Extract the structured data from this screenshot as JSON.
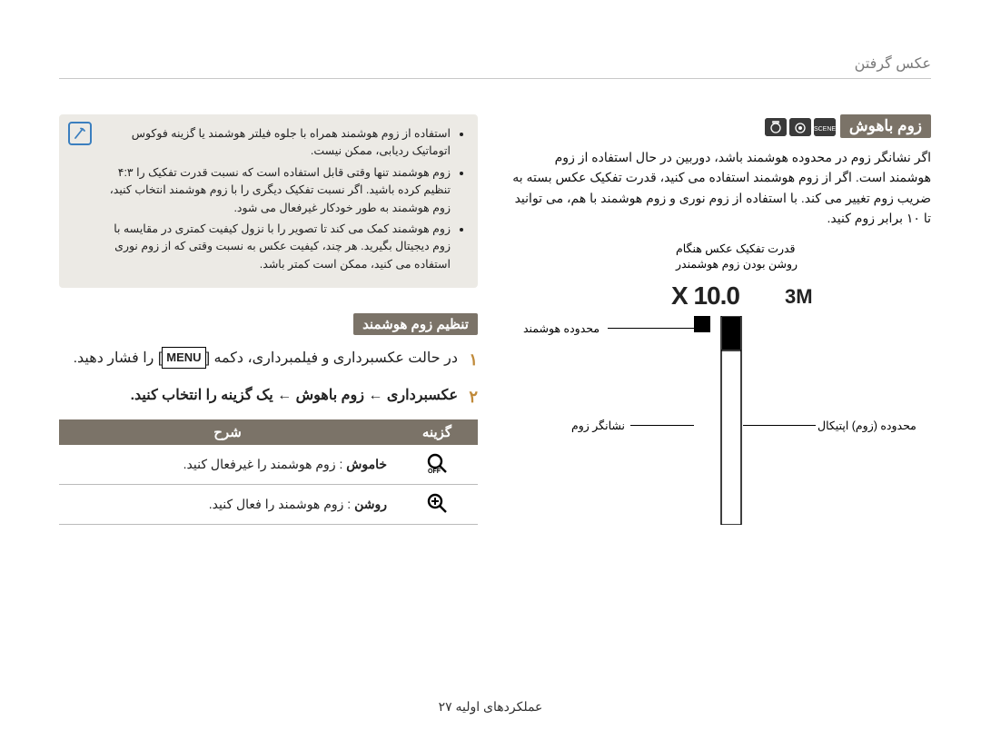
{
  "running_head": "عکس گرفتن",
  "footer": "عملکردهای اولیه ۲۷",
  "right": {
    "heading": "زوم باهوش",
    "para": "اگر نشانگر زوم در محدوده هوشمند باشد، دوربین در حال استفاده از زوم هوشمند است. اگر از زوم هوشمند استفاده می کنید، قدرت تفکیک عکس بسته به ضریب زوم تغییر می کند. با استفاده از زوم نوری و زوم هوشمند با هم، می توانید تا ۱۰ برابر زوم کنید.",
    "labels": {
      "res": "قدرت تفکیک عکس هنگام",
      "sz_on": "روشن بودن زوم هوشمندر",
      "range_smart": "محدوده هوشمند",
      "range_optical": "محدوده (زوم) اپتیکال",
      "zoom_indicator": "نشانگر زوم"
    },
    "diagram": {
      "zoom_text": "X 10.0",
      "size_text": "3M"
    }
  },
  "left": {
    "notes": [
      "استفاده از زوم هوشمند همراه با جلوه فیلتر هوشمند یا گزینه فوکوس اتوماتیک ردیابی، ممکن نیست.",
      "زوم هوشمند تنها وقتی قابل استفاده است که نسبت قدرت تفکیک را ۴:۳ تنظیم کرده باشید. اگر نسبت تفکیک دیگری را با زوم هوشمند انتخاب کنید، زوم هوشمند به طور خودکار غیرفعال می شود.",
      "زوم هوشمند کمک می کند تا تصویر را با نزول کیفیت کمتری در مقایسه با زوم دیجیتال بگیرید. هر چند، کیفیت عکس به نسبت وقتی که از زوم نوری استفاده می کنید، ممکن است کمتر باشد."
    ],
    "subheading": "تنظیم زوم هوشمند",
    "menu_button": "MENU",
    "steps": [
      {
        "num": "۱",
        "before": "در حالت عکسبرداری و فیلمبرداری، دکمه [",
        "after": "] را فشار دهید."
      },
      {
        "num": "۲",
        "text": "عکسبرداری ← زوم باهوش ← یک گزینه را انتخاب کنید."
      }
    ],
    "table": {
      "col_option": "گزینه",
      "col_desc": "شرح",
      "rows": [
        {
          "bold": "خاموش",
          "rest": " : زوم هوشمند را غیرفعال کنید."
        },
        {
          "bold": "روشن",
          "rest": " : زوم هوشمند را فعال کنید."
        }
      ]
    }
  }
}
